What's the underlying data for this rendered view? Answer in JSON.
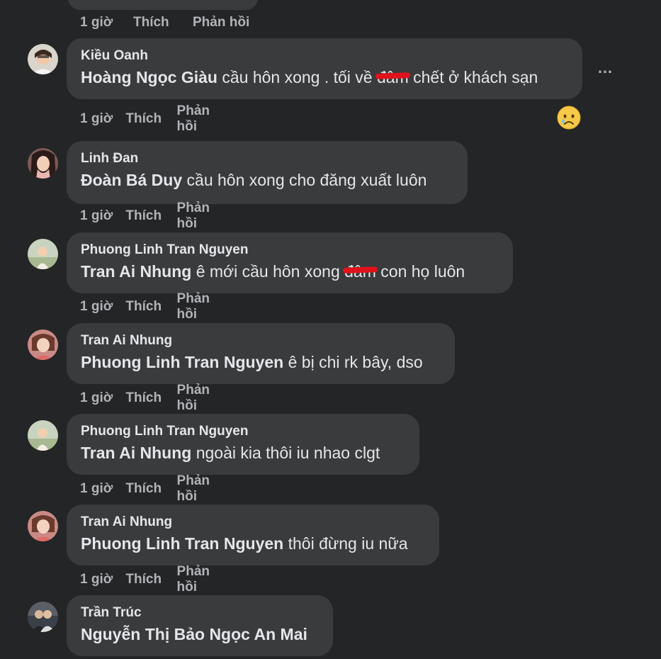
{
  "actions": {
    "time": "1 giờ",
    "like": "Thích",
    "reply": "Phản hồi"
  },
  "top_comment": {
    "time": "1 giờ",
    "like": "Thích",
    "reply": "Phản hồi"
  },
  "more_icon": "…",
  "comments": [
    {
      "author": "Kiều Oanh",
      "mention": "Hoàng Ngọc Giàu",
      "text_before": " cầu hôn xong . tối về ",
      "censored": "đâm",
      "text_after": " chết ở khách sạn",
      "time": "1 giờ",
      "like": "Thích",
      "reply": "Phản hồi",
      "reaction_icon": "sad-face-icon"
    },
    {
      "author": "Linh Đan",
      "mention": "Đoàn Bá Duy",
      "text_before": " cầu hôn xong cho đăng xuất luôn",
      "time": "1 giờ",
      "like": "Thích",
      "reply": "Phản hồi"
    },
    {
      "author": "Phuong Linh Tran Nguyen",
      "mention": "Tran Ai Nhung",
      "text_before": " ê mới cầu hôn xong ",
      "censored": "đâm",
      "text_after": " con họ luôn",
      "time": "1 giờ",
      "like": "Thích",
      "reply": "Phản hồi"
    },
    {
      "author": "Tran Ai Nhung",
      "mention": "Phuong Linh Tran Nguyen",
      "text_before": " ê bị chi rk bây, dso",
      "time": "1 giờ",
      "like": "Thích",
      "reply": "Phản hồi"
    },
    {
      "author": "Phuong Linh Tran Nguyen",
      "mention": "Tran Ai Nhung",
      "text_before": " ngoài kia thôi iu nhao clgt",
      "time": "1 giờ",
      "like": "Thích",
      "reply": "Phản hồi"
    },
    {
      "author": "Tran Ai Nhung",
      "mention": "Phuong Linh Tran Nguyen",
      "text_before": " thôi đừng iu nữa",
      "time": "1 giờ",
      "like": "Thích",
      "reply": "Phản hồi"
    },
    {
      "author": "Trần Trúc",
      "mention": "Nguyễn Thị Bảo Ngọc An Mai",
      "text_before": ""
    }
  ],
  "colors": {
    "background": "#242526",
    "bubble": "#3a3b3c",
    "text": "#e4e6eb",
    "secondary_text": "#b0b3b8",
    "censor_mark": "#e0121b"
  }
}
